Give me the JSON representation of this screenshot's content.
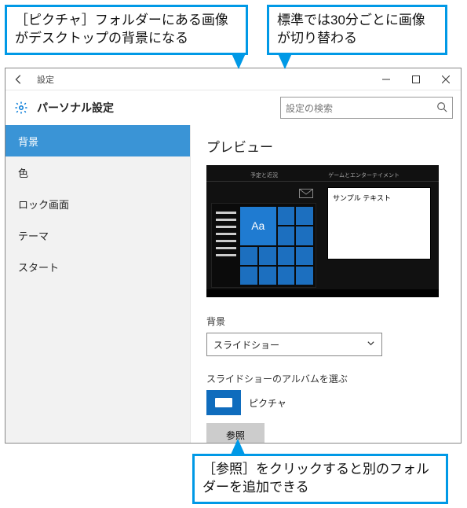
{
  "callouts": {
    "top_left": "［ピクチャ］フォルダーにある画像がデスクトップの背景になる",
    "top_right": "標準では30分ごとに画像が切り替わる",
    "bottom": "［参照］をクリックすると別のフォルダーを追加できる"
  },
  "window": {
    "title": "設定",
    "header": "パーソナル設定",
    "search_placeholder": "設定の検索",
    "sidebar": {
      "items": [
        "背景",
        "色",
        "ロック画面",
        "テーマ",
        "スタート"
      ],
      "active_index": 0
    },
    "content": {
      "preview_heading": "プレビュー",
      "preview_sample_text": "サンプル テキスト",
      "preview_aa": "Aa",
      "preview_tab_left": "予定と近況",
      "preview_tab_right": "ゲームとエンターテイメント",
      "background_label": "背景",
      "background_value": "スライドショー",
      "album_label": "スライドショーのアルバムを選ぶ",
      "album_name": "ピクチャ",
      "browse_label": "参照"
    }
  }
}
